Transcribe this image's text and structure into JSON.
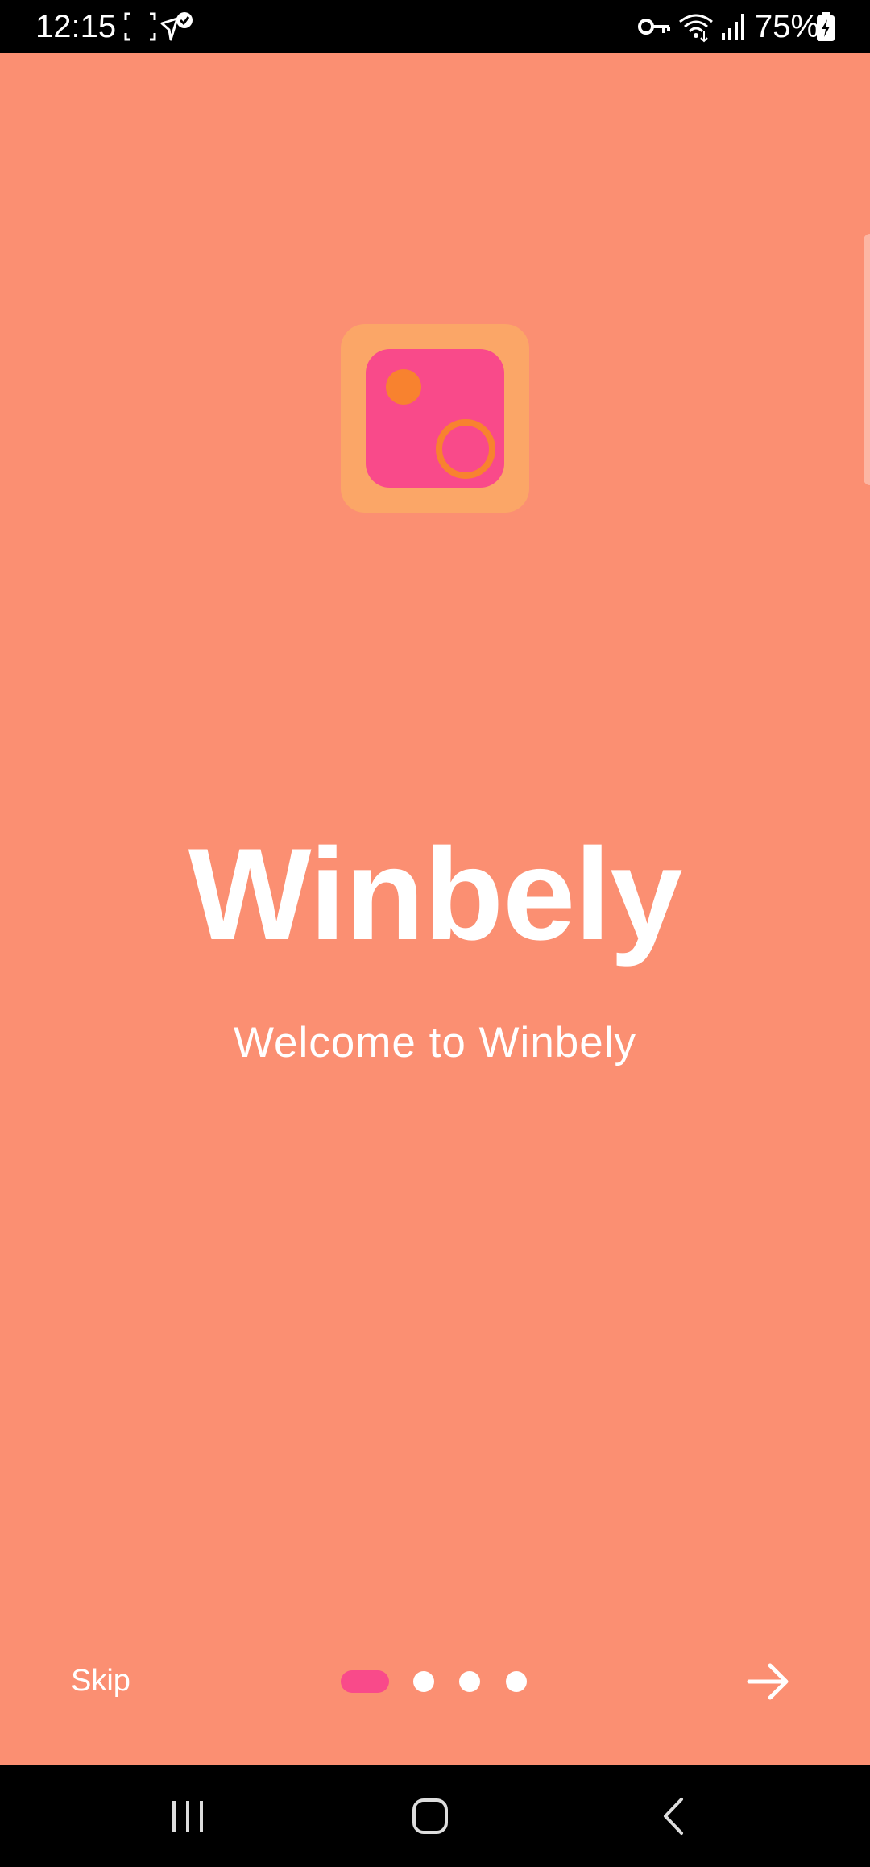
{
  "status_bar": {
    "time": "12:15",
    "battery": "75%",
    "icons": [
      "screenshot-icon",
      "location-check-icon",
      "vpn-key-icon",
      "wifi-icon",
      "signal-icon",
      "battery-charging-icon"
    ]
  },
  "onboarding": {
    "app_name": "Winbely",
    "tagline": "Welcome to Winbely",
    "skip_label": "Skip",
    "page_count": 4,
    "active_page": 1,
    "next_icon": "arrow-right-icon"
  },
  "colors": {
    "background": "#fb8f72",
    "logo_outer": "#fba667",
    "logo_inner": "#f94a8a",
    "logo_accent": "#f8822f",
    "active_dot": "#f94a8a",
    "inactive_dot": "#ffffff"
  },
  "nav_bar": {
    "icons": [
      "recent-apps-icon",
      "home-icon",
      "back-icon"
    ]
  }
}
